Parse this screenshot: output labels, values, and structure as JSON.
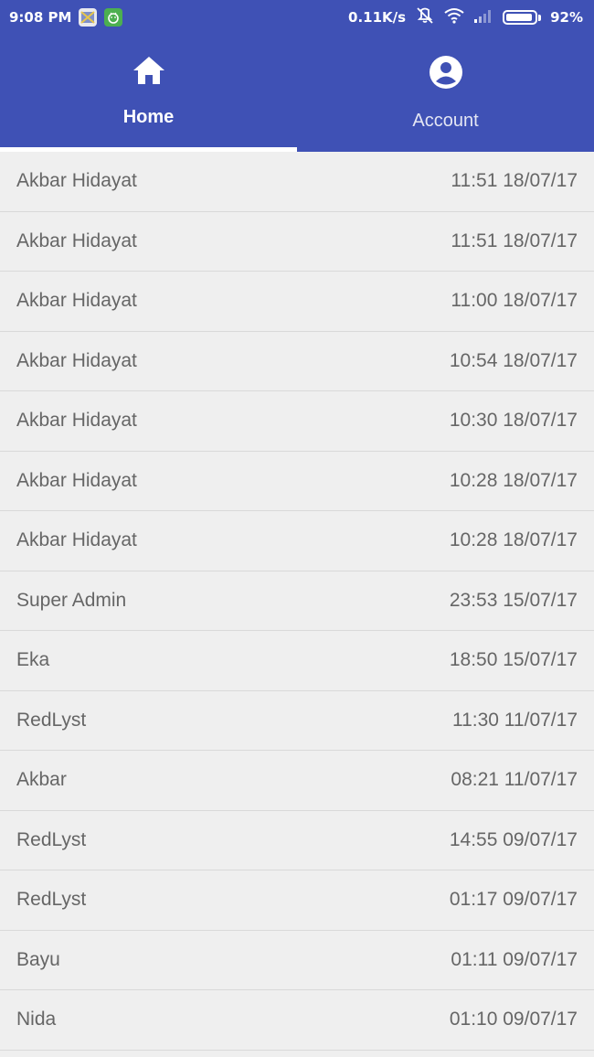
{
  "status_bar": {
    "time": "9:08 PM",
    "network_speed": "0.11K/s",
    "battery_percent": "92%",
    "battery_level": 0.92,
    "icons": [
      "gallery-notification-icon",
      "android-notification-icon",
      "mute-vibrate-icon",
      "wifi-icon",
      "signal-icon",
      "battery-icon"
    ]
  },
  "tabs": [
    {
      "label": "Home",
      "icon": "home-icon",
      "active": true
    },
    {
      "label": "Account",
      "icon": "account-circle-icon",
      "active": false
    }
  ],
  "colors": {
    "primary": "#3f51b5",
    "list_background": "#efefef",
    "divider": "#d9d9d9",
    "row_text": "#666666"
  },
  "rows": [
    {
      "name": "Akbar Hidayat",
      "time": "11:51 18/07/17"
    },
    {
      "name": "Akbar Hidayat",
      "time": "11:51 18/07/17"
    },
    {
      "name": "Akbar Hidayat",
      "time": "11:00 18/07/17"
    },
    {
      "name": "Akbar Hidayat",
      "time": "10:54 18/07/17"
    },
    {
      "name": "Akbar Hidayat",
      "time": "10:30 18/07/17"
    },
    {
      "name": "Akbar Hidayat",
      "time": "10:28 18/07/17"
    },
    {
      "name": "Akbar Hidayat",
      "time": "10:28 18/07/17"
    },
    {
      "name": "Super Admin",
      "time": "23:53 15/07/17"
    },
    {
      "name": "Eka",
      "time": "18:50 15/07/17"
    },
    {
      "name": "RedLyst",
      "time": "11:30 11/07/17"
    },
    {
      "name": "Akbar",
      "time": "08:21 11/07/17"
    },
    {
      "name": "RedLyst",
      "time": "14:55 09/07/17"
    },
    {
      "name": "RedLyst",
      "time": "01:17 09/07/17"
    },
    {
      "name": "Bayu",
      "time": "01:11 09/07/17"
    },
    {
      "name": "Nida",
      "time": "01:10 09/07/17"
    }
  ]
}
